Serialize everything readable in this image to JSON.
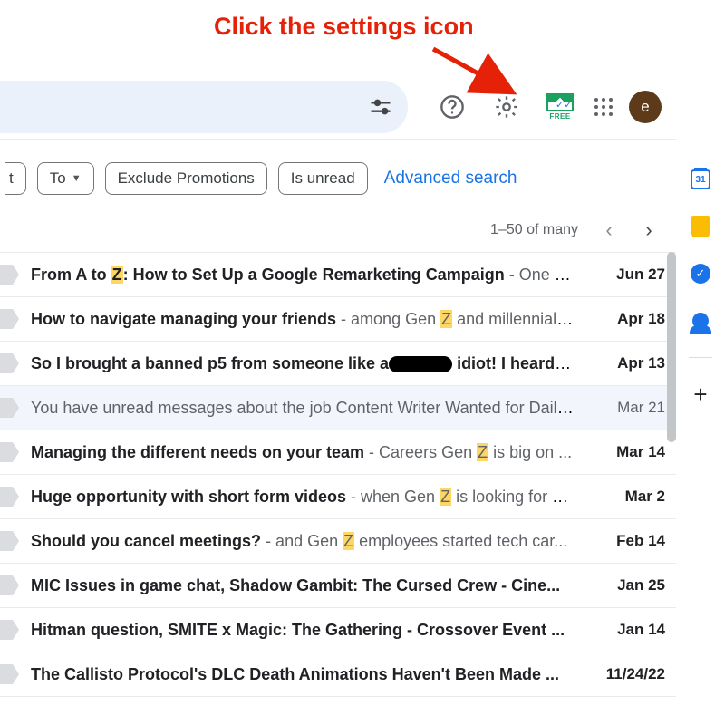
{
  "annotation": {
    "text": "Click the settings icon"
  },
  "search": {
    "placeholder": ""
  },
  "sidepanel": {
    "calendar_day": "31"
  },
  "toolbar": {
    "free_label": "FREE",
    "avatar_letter": "e"
  },
  "filters": {
    "chip_cut": "t",
    "to": "To",
    "exclude_promotions": "Exclude Promotions",
    "is_unread": "Is unread",
    "advanced": "Advanced search"
  },
  "pagination": {
    "range": "1–50 of many"
  },
  "highlight_letter": "Z",
  "rows": [
    {
      "subj_a": "From A to ",
      "subj_b": ": How to Set Up a Google Remarketing Campaign",
      "snip": " - One o...",
      "date": "Jun 27",
      "hl": true,
      "read": false
    },
    {
      "subj_a": "How to navigate managing your friends",
      "snip_a": " - among Gen ",
      "snip_b": " and millennials...",
      "date": "Apr 18",
      "hl_snip": true,
      "read": false
    },
    {
      "subj_a": "So I brought a banned p5 from someone like a",
      "subj_redact": true,
      "subj_b": " idiot! I heard y...",
      "snip": "",
      "date": "Apr 13",
      "read": false
    },
    {
      "subj_a": "You have unread messages about the job Content Writer Wanted for Daily...",
      "snip": "",
      "date": "Mar 21",
      "read": true
    },
    {
      "subj_a": "Managing the different needs on your team",
      "snip_a": " - Careers Gen ",
      "snip_b": " is big on ...",
      "date": "Mar 14",
      "hl_snip": true,
      "read": false
    },
    {
      "subj_a": "Huge opportunity with short form videos",
      "snip_a": " - when Gen ",
      "snip_b": " is looking for a ...",
      "date": "Mar 2",
      "hl_snip": true,
      "read": false
    },
    {
      "subj_a": "Should you cancel meetings?",
      "snip_a": " - and Gen ",
      "snip_b": " employees started tech car...",
      "date": "Feb 14",
      "hl_snip": true,
      "read": false
    },
    {
      "subj_a": "MIC Issues in game chat, Shadow Gambit: The Cursed Crew - Cine...",
      "snip": "",
      "date": "Jan 25",
      "read": false
    },
    {
      "subj_a": "Hitman question, SMITE x Magic: The Gathering - Crossover Event ...",
      "snip": "",
      "date": "Jan 14",
      "read": false
    },
    {
      "subj_a": "The Callisto Protocol's DLC Death Animations Haven't Been Made ...",
      "snip": "",
      "date": "11/24/22",
      "read": false
    }
  ]
}
